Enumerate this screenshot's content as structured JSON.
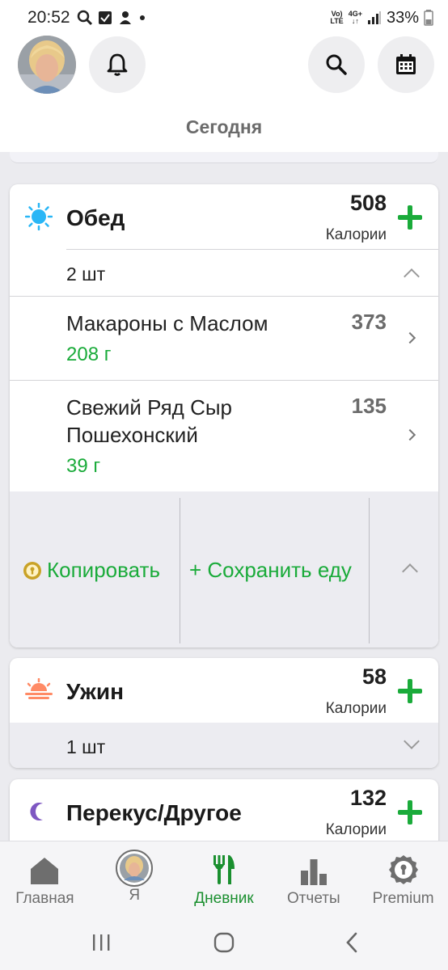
{
  "status_bar": {
    "time": "20:52",
    "network_label_top": "Vo)",
    "network_label_bottom": "LTE",
    "network_gen_top": "4G+",
    "network_gen_bottom": "↓↑",
    "battery": "33%"
  },
  "header": {
    "title": "Сегодня"
  },
  "meals": [
    {
      "name": "Обед",
      "icon": "sun-icon",
      "calories": "508",
      "calories_label": "Калории",
      "count": "2 шт",
      "items": [
        {
          "name": "Макароны с Маслом",
          "qty": "208 г",
          "calories": "373"
        },
        {
          "name": "Свежий Ряд Сыр Пошехонский",
          "qty": "39 г",
          "calories": "135"
        }
      ],
      "actions": {
        "copy": "Копировать",
        "save": "+ Сохранить еду"
      }
    },
    {
      "name": "Ужин",
      "icon": "sunset-icon",
      "calories": "58",
      "calories_label": "Калории",
      "count": "1 шт"
    },
    {
      "name": "Перекус/Другое",
      "icon": "moon-icon",
      "calories": "132",
      "calories_label": "Калории"
    }
  ],
  "bottom_nav": [
    {
      "label": "Главная",
      "icon": "home-icon",
      "active": false
    },
    {
      "label": "Я",
      "icon": "avatar-icon",
      "active": false
    },
    {
      "label": "Дневник",
      "icon": "fork-knife-icon",
      "active": true
    },
    {
      "label": "Отчеты",
      "icon": "bar-chart-icon",
      "active": false
    },
    {
      "label": "Premium",
      "icon": "premium-badge-icon",
      "active": false
    }
  ],
  "colors": {
    "accent_green": "#1aab3a",
    "nav_active": "#1a8f2f",
    "sun": "#29b6f6",
    "sunset": "#ff8a65",
    "moon": "#7e57c2",
    "premium_gold": "#c9a227"
  }
}
